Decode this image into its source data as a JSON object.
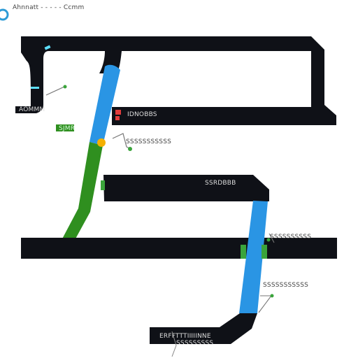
{
  "canvas": {
    "background": "#ffffff"
  },
  "top_left": {
    "logo_icon": "logo-ring-icon",
    "text": "Ahnnatt - - - - - Ccmm"
  },
  "labels": {
    "left_box": "AOMMM",
    "green_tag": "SJMR",
    "upper_track_label": "IDNOBBS",
    "upper_track_note": "SSSSSSSSSSS",
    "middle_track_label": "SSRDBBB",
    "right_note": "SSSSSSSSSS",
    "lower_note": "SSSSSSSSSSS",
    "bottom_track_label": "ERFFTTTIIIIINNE",
    "bottom_track_underline": "SSSSSSSSS"
  },
  "colors": {
    "track_dark": "#0f1117",
    "track_mid": "#111318",
    "blue_segment": "#2a95e4",
    "green_segment": "#2f8f1f",
    "accent_orange": "#f4b000",
    "accent_red": "#e23c3c",
    "accent_cyan": "#5de0ff",
    "green_marker": "#3aa43b",
    "green_tag_bg": "#2f8f1f"
  }
}
